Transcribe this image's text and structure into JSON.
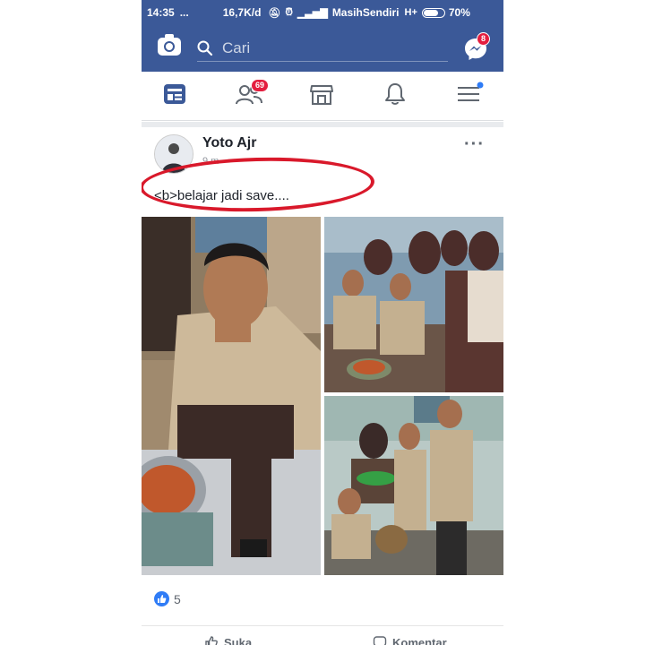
{
  "status_bar": {
    "time": "14:35",
    "dots": "...",
    "net_speed": "16,7K/d",
    "carrier": "MasihSendiri",
    "network_type": "H+",
    "battery": "70%"
  },
  "header": {
    "search_placeholder": "Cari",
    "messenger_badge": "8"
  },
  "nav": {
    "friends_badge": "69"
  },
  "post": {
    "author": "Yoto Ajr",
    "time_text": "9 m",
    "caption": "<b>belajar jadi save....",
    "likes_count": "5",
    "actions": {
      "like": "Suka",
      "comment": "Komentar"
    }
  },
  "colors": {
    "brand": "#3b5998",
    "badge": "#e41e3f",
    "annotation_circle": "#d9192b",
    "like_blue": "#2f7cf6"
  }
}
